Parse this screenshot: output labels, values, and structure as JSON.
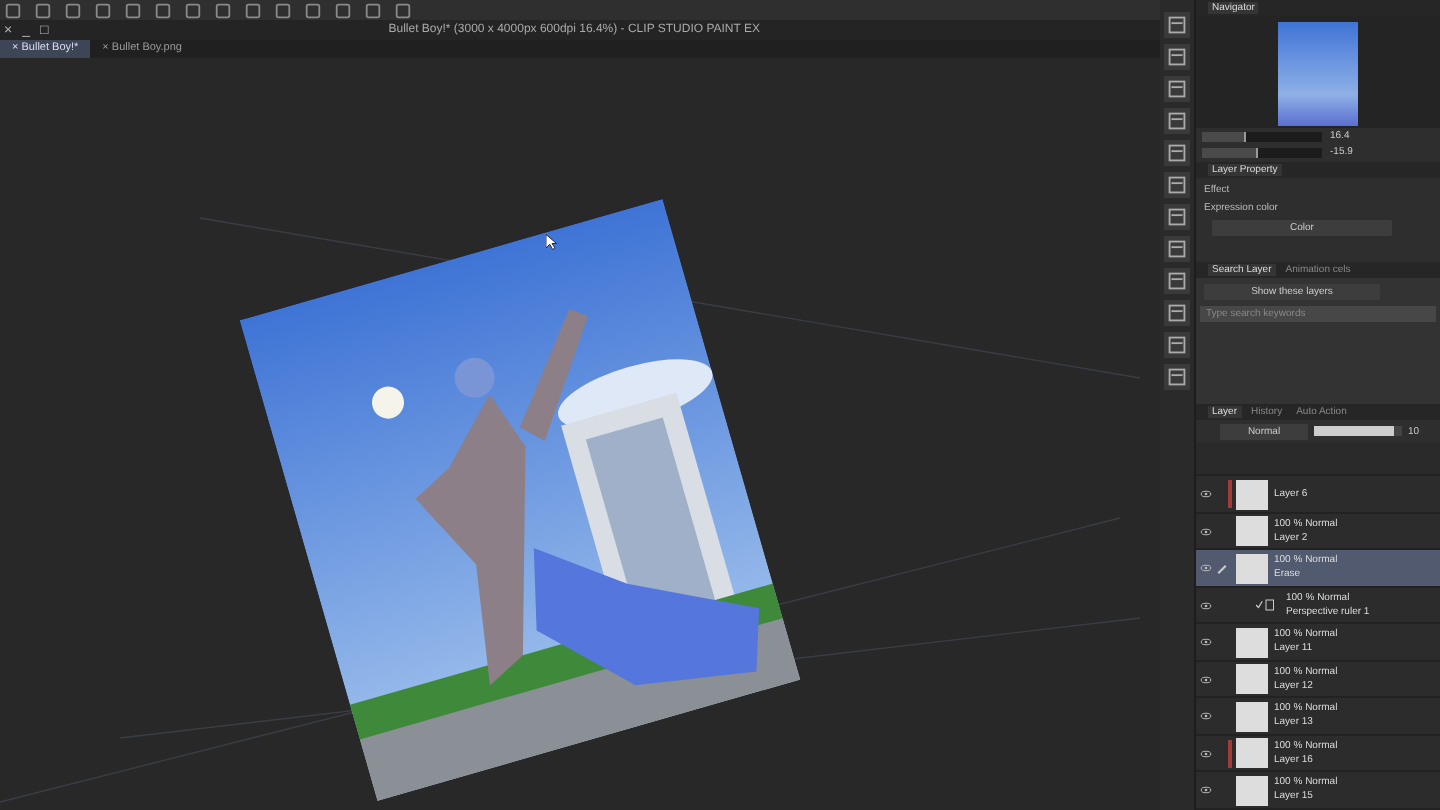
{
  "window": {
    "title": "Bullet Boy!* (3000 x 4000px 600dpi 16.4%) - CLIP STUDIO PAINT EX",
    "controls": [
      "×",
      "_",
      "□"
    ]
  },
  "tabs": [
    {
      "label": "Bullet Boy!*",
      "close": "×",
      "selected": true
    },
    {
      "label": "Bullet Boy.png",
      "close": "×",
      "selected": false
    }
  ],
  "navigator": {
    "title": "Navigator",
    "zoom_value": "16.4",
    "angle_value": "-15.9",
    "zoom_slider": {
      "level": 0.35
    },
    "angle_slider": {
      "level": 0.45
    }
  },
  "layer_property": {
    "title": "Layer Property",
    "effect_label": "Effect",
    "expression_color_label": "Expression color",
    "expression_color": "Color"
  },
  "search_layer": {
    "tabs": [
      {
        "label": "Search Layer",
        "selected": true
      },
      {
        "label": "Animation cels",
        "selected": false
      }
    ],
    "filter": "Show these layers",
    "placeholder": "Type search keywords"
  },
  "layer_panel": {
    "tabs": [
      {
        "label": "Layer",
        "selected": true
      },
      {
        "label": "History",
        "selected": false
      },
      {
        "label": "Auto Action",
        "selected": false
      }
    ],
    "blend_mode": "Normal",
    "opacity_slider": {
      "level": 0.92
    },
    "opacity_value": "10",
    "layers": [
      {
        "kind": "raster",
        "name": "Layer 6",
        "selected": false,
        "color": "#a33a3a"
      },
      {
        "kind": "raster",
        "mode": "100 % Normal",
        "name": "Layer 2",
        "selected": false
      },
      {
        "kind": "raster",
        "mode": "100 % Normal",
        "name": "Erase",
        "selected": true
      },
      {
        "kind": "ruler",
        "mode": "100 % Normal",
        "name": "Perspective ruler 1",
        "selected": false
      },
      {
        "kind": "raster",
        "mode": "100 % Normal",
        "name": "Layer 11",
        "selected": false
      },
      {
        "kind": "raster",
        "mode": "100 % Normal",
        "name": "Layer 12",
        "selected": false
      },
      {
        "kind": "raster",
        "mode": "100 % Normal",
        "name": "Layer 13",
        "selected": false
      },
      {
        "kind": "raster",
        "mode": "100 % Normal",
        "name": "Layer 16",
        "selected": false,
        "color": "#a33a3a"
      },
      {
        "kind": "raster",
        "mode": "100 % Normal",
        "name": "Layer 15",
        "selected": false
      }
    ]
  }
}
